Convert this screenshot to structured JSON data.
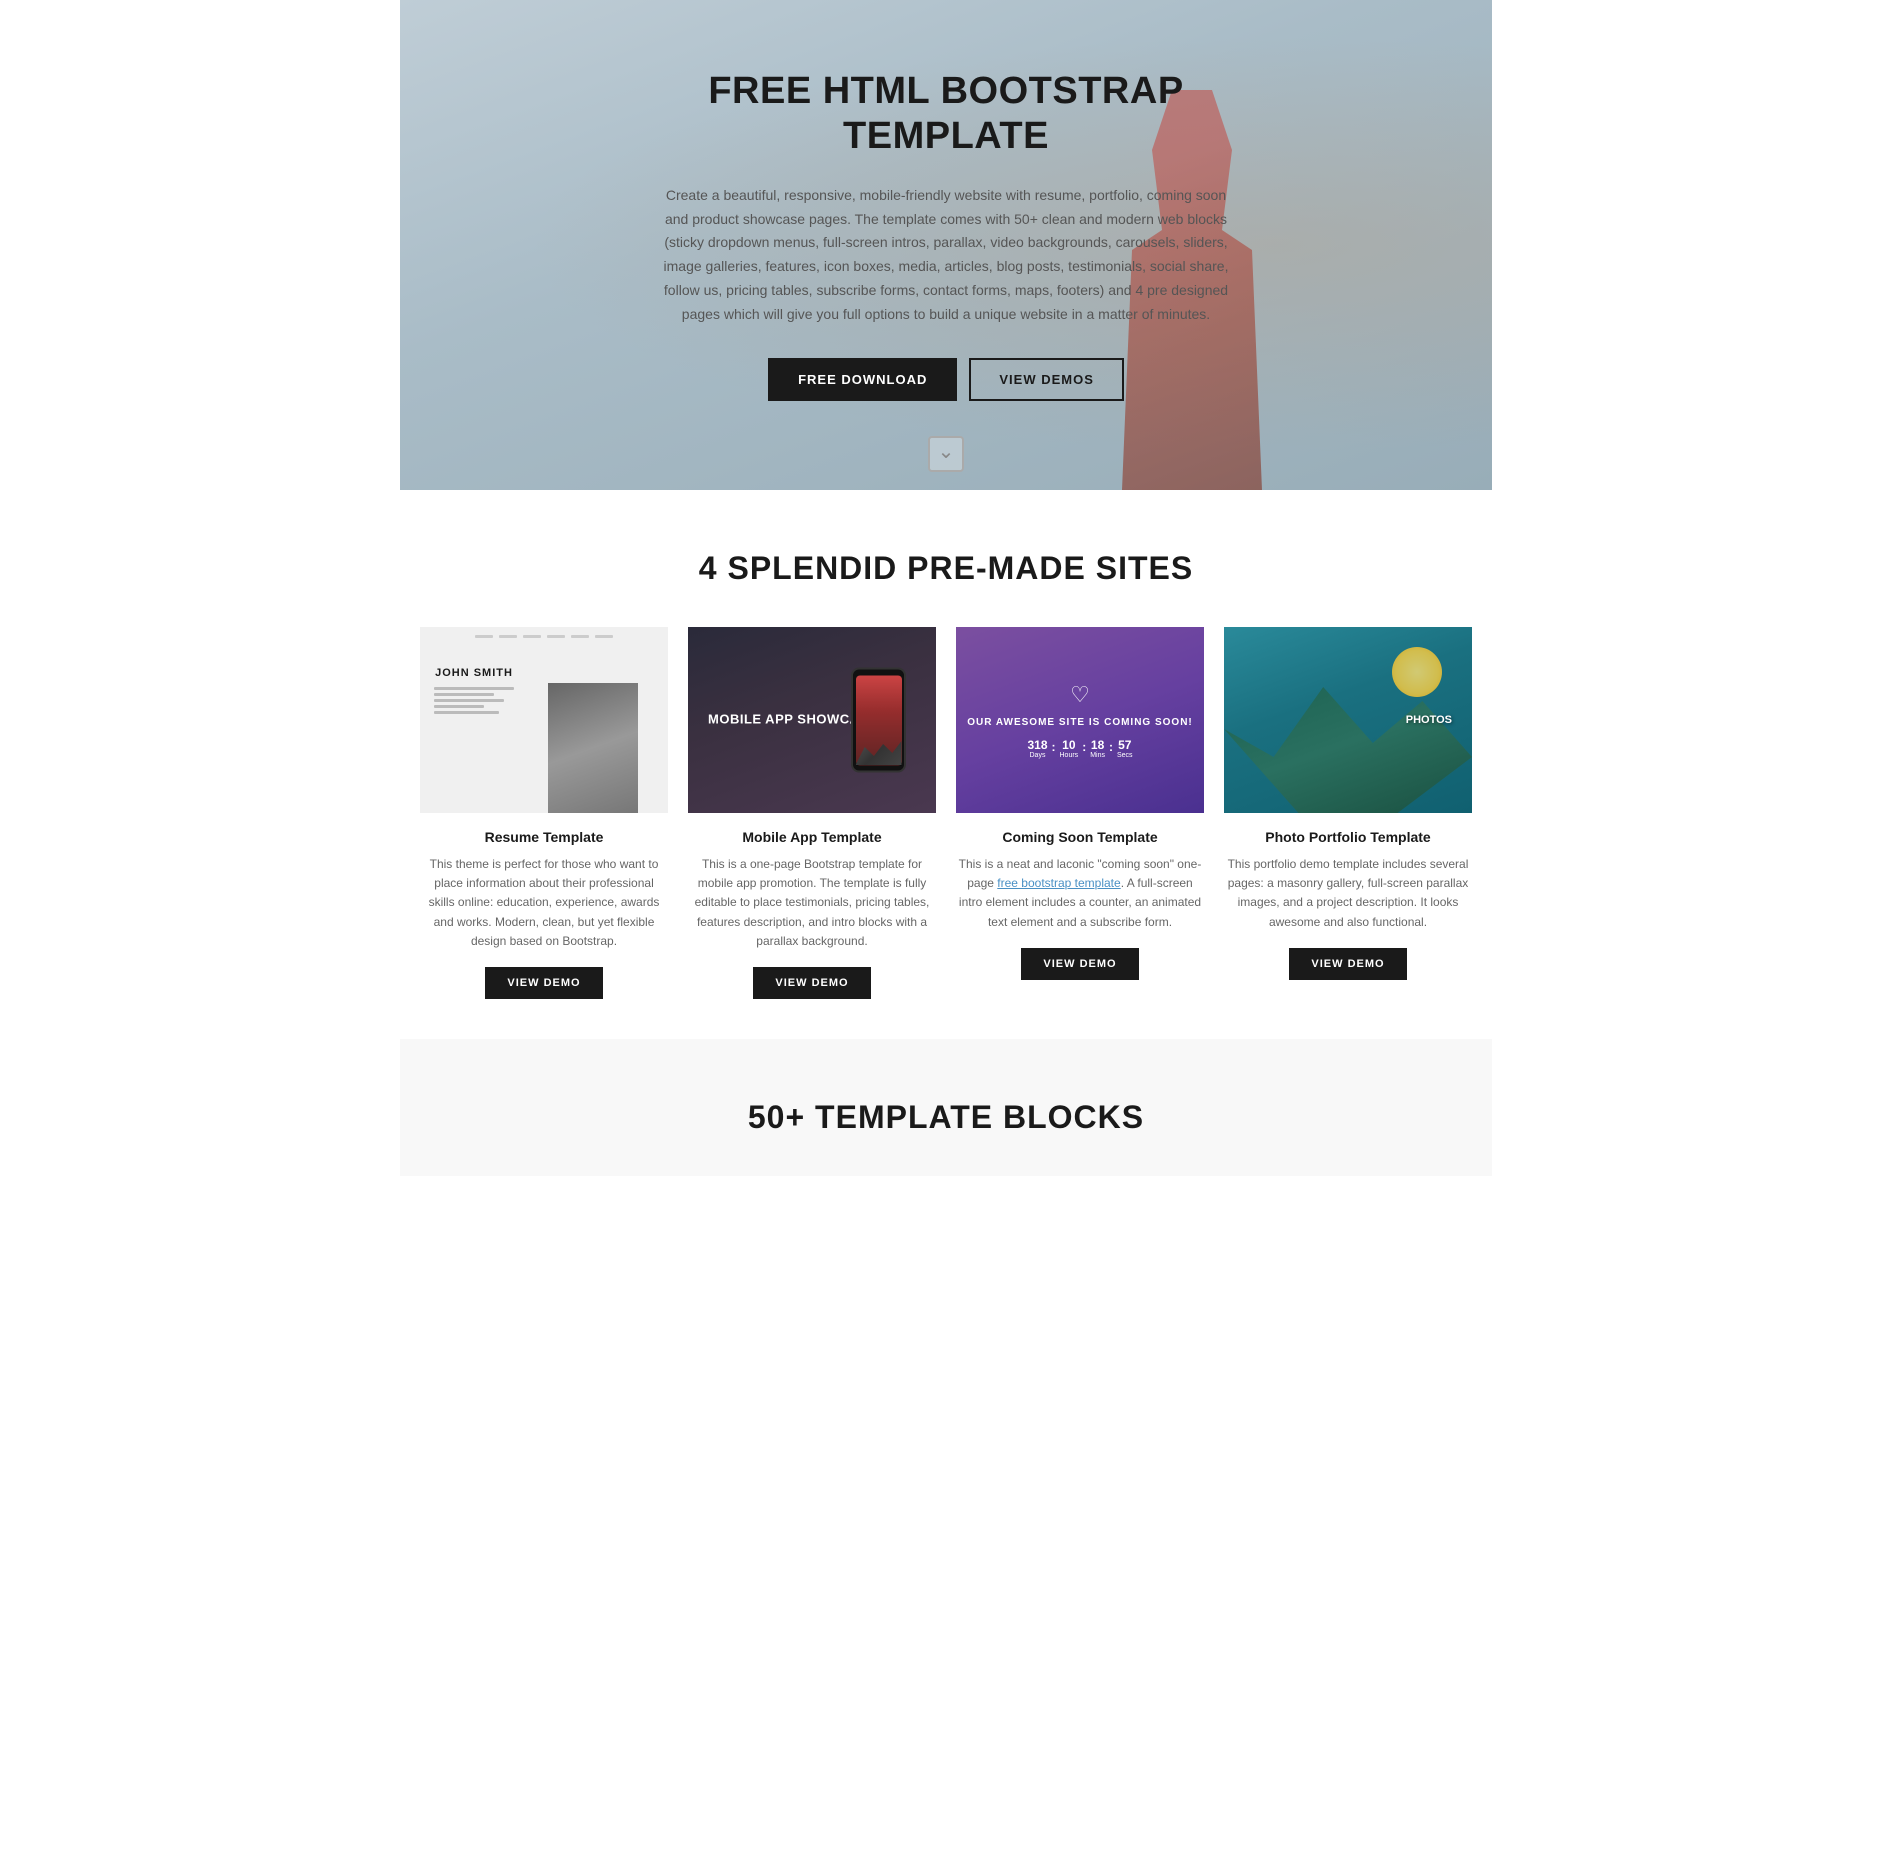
{
  "hero": {
    "title": "FREE HTML BOOTSTRAP TEMPLATE",
    "description": "Create a beautiful, responsive, mobile-friendly website with resume, portfolio, coming soon and product showcase pages. The template comes with 50+ clean and modern web blocks (sticky dropdown menus, full-screen intros, parallax, video backgrounds, carousels, sliders, image galleries, features, icon boxes, media, articles, blog posts, testimonials, social share, follow us, pricing tables, subscribe forms, contact forms, maps, footers) and 4 pre designed pages which will give you full options to build a unique website in a matter of minutes.",
    "btn_download": "FREE DOWNLOAD",
    "btn_demos": "VIEW DEMOS"
  },
  "premade": {
    "title": "4 SPLENDID PRE-MADE SITES",
    "cards": [
      {
        "name": "Resume Template",
        "description": "This theme is perfect for those who want to place information about their professional skills online: education, experience, awards and works. Modern, clean, but yet flexible design based on Bootstrap.",
        "btn": "VIEW DEMO",
        "preview_type": "resume"
      },
      {
        "name": "Mobile App Template",
        "description": "This is a one-page Bootstrap template for mobile app promotion. The template is fully editable to place testimonials, pricing tables, features description, and intro blocks with a parallax background.",
        "btn": "VIEW DEMO",
        "preview_type": "mobile",
        "preview_text": "MOBILE APP SHOWCASE"
      },
      {
        "name": "Coming Soon Template",
        "description": "This is a neat and laconic \"coming soon\" one-page free bootstrap template. A full-screen intro element includes a counter, an animated text element and a subscribe form.",
        "btn": "VIEW DEMO",
        "preview_type": "coming-soon",
        "cs_title": "OUR AWESOME SITE IS COMING SOON!",
        "cs_counter": [
          "318",
          "10",
          "18",
          "57"
        ]
      },
      {
        "name": "Photo Portfolio Template",
        "description": "This portfolio demo template includes several pages: a masonry gallery, full-screen parallax images, and a project description. It looks awesome and also functional.",
        "btn": "VIEW DEMO",
        "preview_type": "portfolio",
        "preview_text": "PHOTOS"
      }
    ]
  },
  "blocks": {
    "title": "50+ TEMPLATE BLOCKS"
  },
  "resume_person": "JOHN SMITH"
}
